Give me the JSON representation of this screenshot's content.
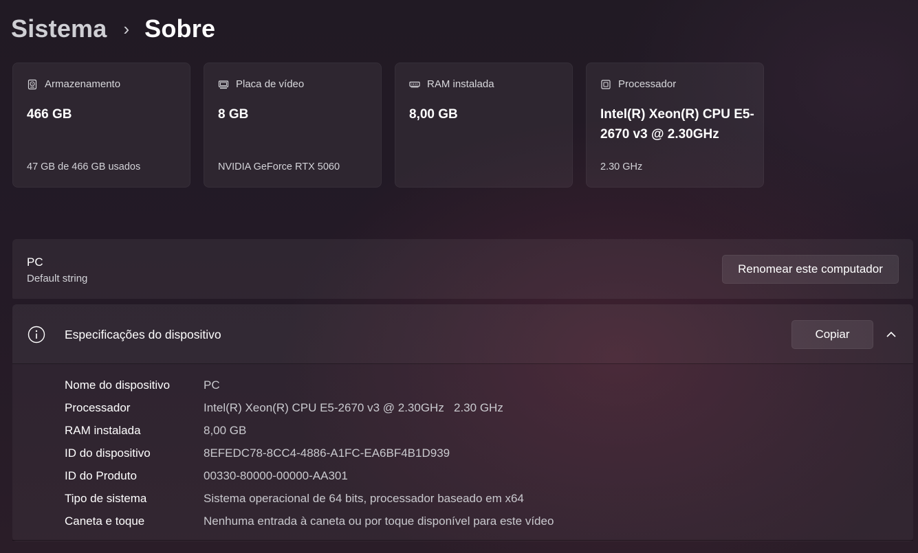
{
  "breadcrumb": {
    "parent": "Sistema",
    "separator": "›",
    "current": "Sobre"
  },
  "cards": [
    {
      "icon": "hard-drive-icon",
      "label": "Armazenamento",
      "value": "466 GB",
      "sub": "47 GB de 466 GB usados"
    },
    {
      "icon": "graphics-card-icon",
      "label": "Placa de vídeo",
      "value": "8 GB",
      "sub": "NVIDIA GeForce RTX 5060"
    },
    {
      "icon": "ram-icon",
      "label": "RAM instalada",
      "value": "8,00 GB",
      "sub": ""
    },
    {
      "icon": "processor-icon",
      "label": "Processador",
      "value": "Intel(R) Xeon(R) CPU E5-2670 v3 @ 2.30GHz",
      "sub": "2.30 GHz"
    }
  ],
  "pc": {
    "name": "PC",
    "model": "Default string",
    "rename_label": "Renomear este computador"
  },
  "specs": {
    "title": "Especificações do dispositivo",
    "copy_label": "Copiar",
    "rows": [
      {
        "key": "Nome do dispositivo",
        "value": "PC"
      },
      {
        "key": "Processador",
        "value": "Intel(R) Xeon(R) CPU E5-2670 v3 @ 2.30GHz   2.30 GHz"
      },
      {
        "key": "RAM instalada",
        "value": "8,00 GB"
      },
      {
        "key": "ID do dispositivo",
        "value": "8EFEDC78-8CC4-4886-A1FC-EA6BF4B1D939"
      },
      {
        "key": "ID do Produto",
        "value": "00330-80000-00000-AA301"
      },
      {
        "key": "Tipo de sistema",
        "value": "Sistema operacional de 64 bits, processador baseado em x64"
      },
      {
        "key": "Caneta e toque",
        "value": "Nenhuma entrada à caneta ou por toque disponível para este vídeo"
      }
    ]
  },
  "colors": {
    "background": "#221a25",
    "card": "#2e2830",
    "text_primary": "#ffffff",
    "text_secondary": "#c9c9ce"
  }
}
